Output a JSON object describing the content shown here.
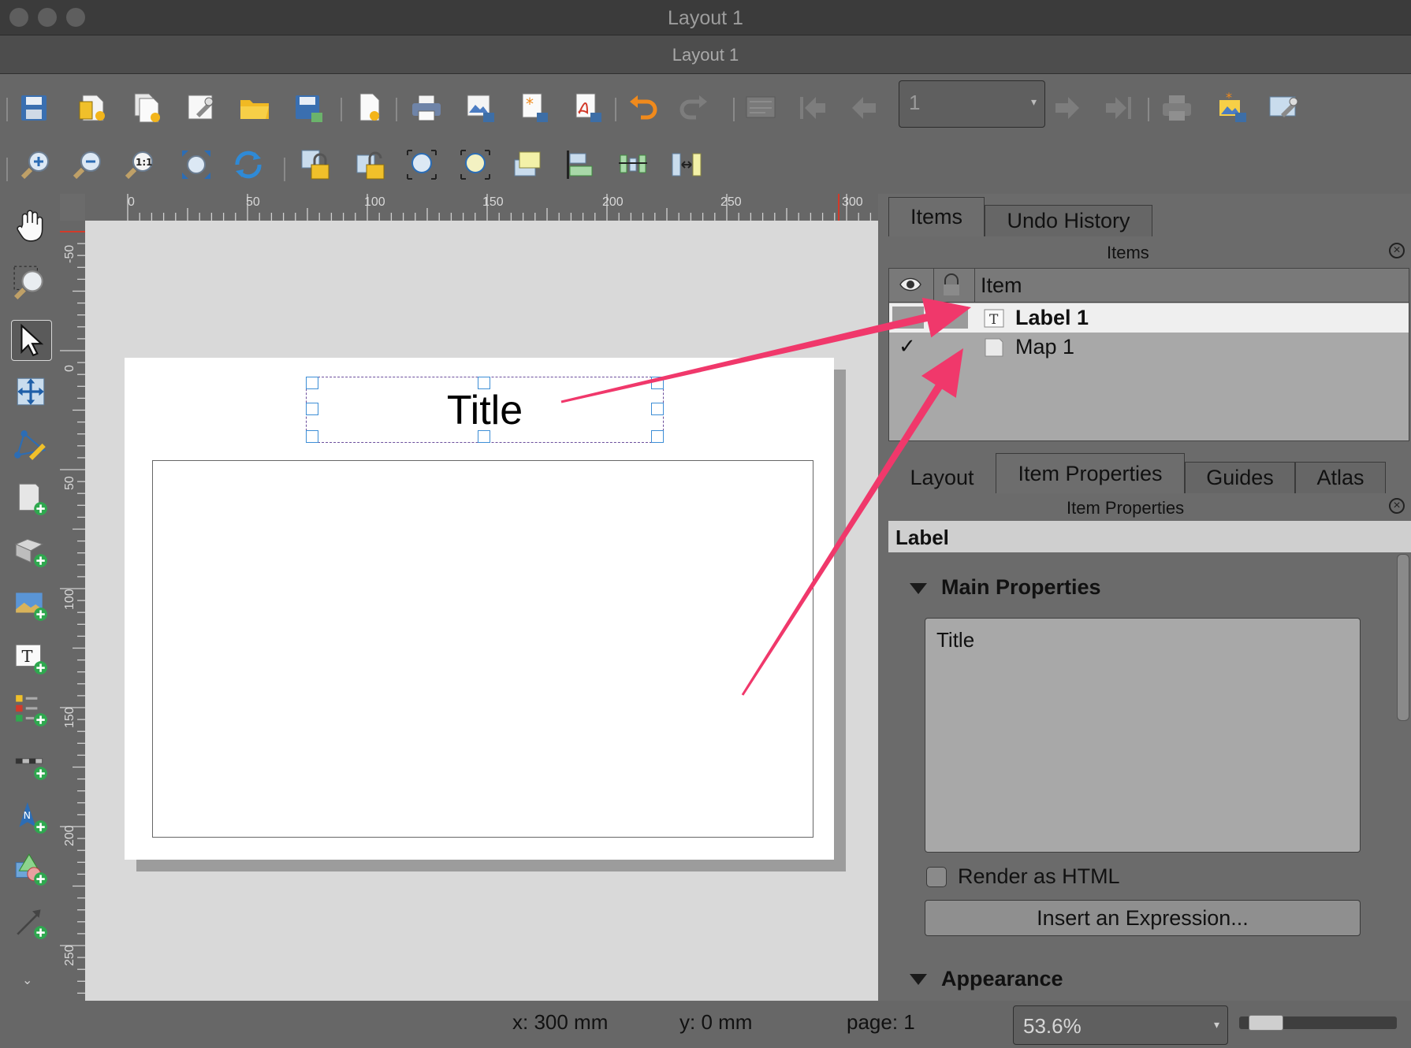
{
  "window": {
    "title": "Layout 1",
    "subtitle": "Layout 1"
  },
  "toolbar": {
    "page_selector": {
      "value": "1"
    },
    "top_icons": [
      "save-layout-icon",
      "new-layout-icon",
      "duplicate-layout-icon",
      "layout-manager-icon",
      "open-template-icon",
      "save-as-template-icon",
      "new-from-template-icon",
      "print-icon",
      "export-image-icon",
      "export-svg-icon",
      "export-pdf-icon",
      "undo-icon",
      "redo-icon",
      "atlas-preview-icon",
      "first-feature-icon",
      "previous-feature-icon",
      "next-feature-icon",
      "last-feature-icon",
      "atlas-print-icon",
      "atlas-export-icon",
      "atlas-settings-icon"
    ],
    "nav_icons": [
      "zoom-in-icon",
      "zoom-out-icon",
      "zoom-actual-icon",
      "zoom-full-icon",
      "refresh-icon",
      "lock-items-icon",
      "unlock-items-icon",
      "select-all-icon",
      "deselect-icon",
      "raise-items-icon",
      "align-left-icon",
      "distribute-icon",
      "resize-icon"
    ]
  },
  "tools": [
    "pan-icon",
    "zoom-tool-icon",
    "select-move-icon",
    "move-content-icon",
    "edit-nodes-icon",
    "add-map-icon",
    "add-3d-map-icon",
    "add-picture-icon",
    "add-label-icon",
    "add-legend-icon",
    "add-scalebar-icon",
    "add-north-arrow-icon",
    "add-shape-icon",
    "add-arrow-icon"
  ],
  "rulers": {
    "horizontal": [
      "0",
      "50",
      "100",
      "150",
      "200",
      "250",
      "300"
    ],
    "vertical": [
      "-50",
      "0",
      "50",
      "100",
      "150",
      "200",
      "250"
    ]
  },
  "canvas": {
    "label_text": "Title"
  },
  "items_dock": {
    "tabs": [
      "Items",
      "Undo History"
    ],
    "active_tab": "Items",
    "title": "Items",
    "columns": {
      "item": "Item"
    },
    "rows": [
      {
        "name": "Label 1",
        "visible": false,
        "selected": true,
        "icon": "label-item-icon"
      },
      {
        "name": "Map 1",
        "visible": true,
        "selected": false,
        "icon": "map-item-icon",
        "check": "✓"
      }
    ]
  },
  "properties_dock": {
    "tabs": [
      "Layout",
      "Item Properties",
      "Guides",
      "Atlas"
    ],
    "active_tab": "Item Properties",
    "title": "Item Properties",
    "section_title": "Label",
    "main_properties": "Main Properties",
    "label_text": "Title",
    "render_as_html": {
      "label": "Render as HTML",
      "checked": false
    },
    "insert_expression": "Insert an Expression...",
    "appearance": "Appearance"
  },
  "status": {
    "x": "x: 300 mm",
    "y": "y: 0 mm",
    "page": "page: 1",
    "zoom": "53.6%",
    "zoom_slider_fraction": 0.08
  },
  "colors": {
    "annotation_arrow": "#f0386b",
    "selection_handle": "#3d8ed6"
  }
}
